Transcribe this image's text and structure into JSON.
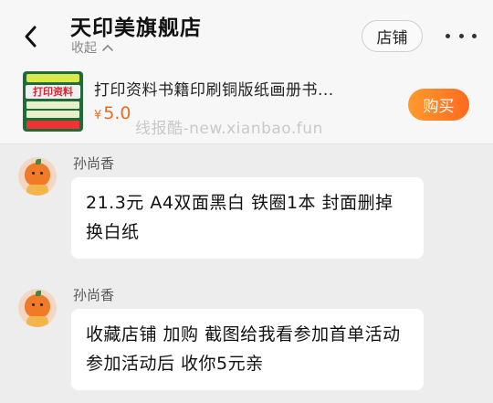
{
  "header": {
    "title": "天印美旗舰店",
    "collapse_label": "收起",
    "store_button": "店铺"
  },
  "product": {
    "title": "打印资料书籍印刷铜版纸画册书...",
    "currency": "¥",
    "price": "5.0",
    "buy_button": "购买",
    "thumb_label": "打印资料"
  },
  "watermark": "线报酷-new.xianbao.fun",
  "messages": [
    {
      "sender": "孙尚香",
      "text": "21.3元 A4双面黑白 铁圈1本 封面删掉换白纸"
    },
    {
      "sender": "孙尚香",
      "text": "收藏店铺 加购 截图给我看参加首单活动 参加活动后 收你5元亲"
    }
  ],
  "colors": {
    "accent": "#f26a21",
    "background": "#ededed",
    "bubble": "#ffffff"
  }
}
